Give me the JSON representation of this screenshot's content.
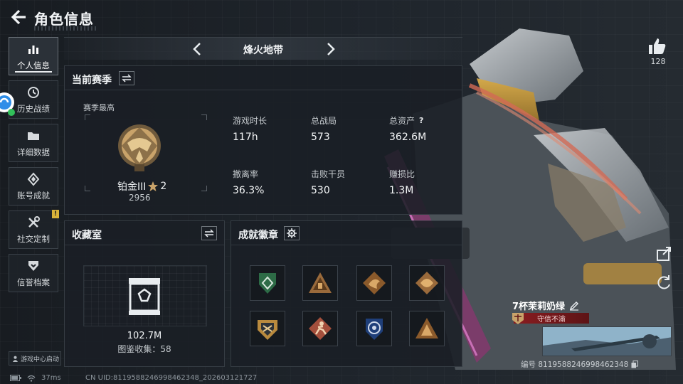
{
  "header": {
    "title": "角色信息"
  },
  "sidebar": {
    "items": [
      {
        "label": "个人信息",
        "icon": "bar-chart-icon",
        "active": true
      },
      {
        "label": "历史战绩",
        "icon": "history-clock-icon"
      },
      {
        "label": "详细数据",
        "icon": "folder-icon"
      },
      {
        "label": "账号成就",
        "icon": "achievement-icon"
      },
      {
        "label": "社交定制",
        "icon": "tools-icon",
        "notice": "!"
      },
      {
        "label": "信誉档案",
        "icon": "shield-check-icon"
      }
    ],
    "launch_label": "游戏中心启动"
  },
  "season_nav": {
    "name": "烽火地带"
  },
  "season_panel": {
    "title": "当前赛季",
    "subtitle": "赛季最高",
    "rank_name": "铂金III",
    "rank_stars": "2",
    "rank_score": "2956",
    "stats": [
      {
        "label": "游戏时长",
        "value": "117h"
      },
      {
        "label": "总战局",
        "value": "573"
      },
      {
        "label": "总资产",
        "value": "362.6M",
        "help": "?"
      },
      {
        "label": "撤离率",
        "value": "36.3%"
      },
      {
        "label": "击败干员",
        "value": "530"
      },
      {
        "label": "赚损比",
        "value": "1.3M"
      }
    ]
  },
  "vault_panel": {
    "title": "收藏室",
    "value": "102.7M",
    "collection_label": "图鉴收集：58"
  },
  "badge_panel": {
    "title": "成就徽章",
    "badges": [
      "green-shield-badge",
      "bronze-pyramid-badge",
      "bronze-dragon-badge",
      "bronze-dragon-badge-2",
      "gold-emblem-badge",
      "bronze-runner-badge",
      "blue-target-badge",
      "bronze-triangle-badge"
    ]
  },
  "profile": {
    "likes": "128",
    "player_name": "7杯茉莉奶绿",
    "credit_status": "守信不渝",
    "uid_line": "编号 8119588246998462348"
  },
  "footer": {
    "ping": "37ms",
    "uid": "CN UID:8119588246998462348_202603121727"
  },
  "colors": {
    "accent_white": "#e9ecef",
    "credit_red": "#8a1c20",
    "rank_gold": "#c9a36a"
  }
}
